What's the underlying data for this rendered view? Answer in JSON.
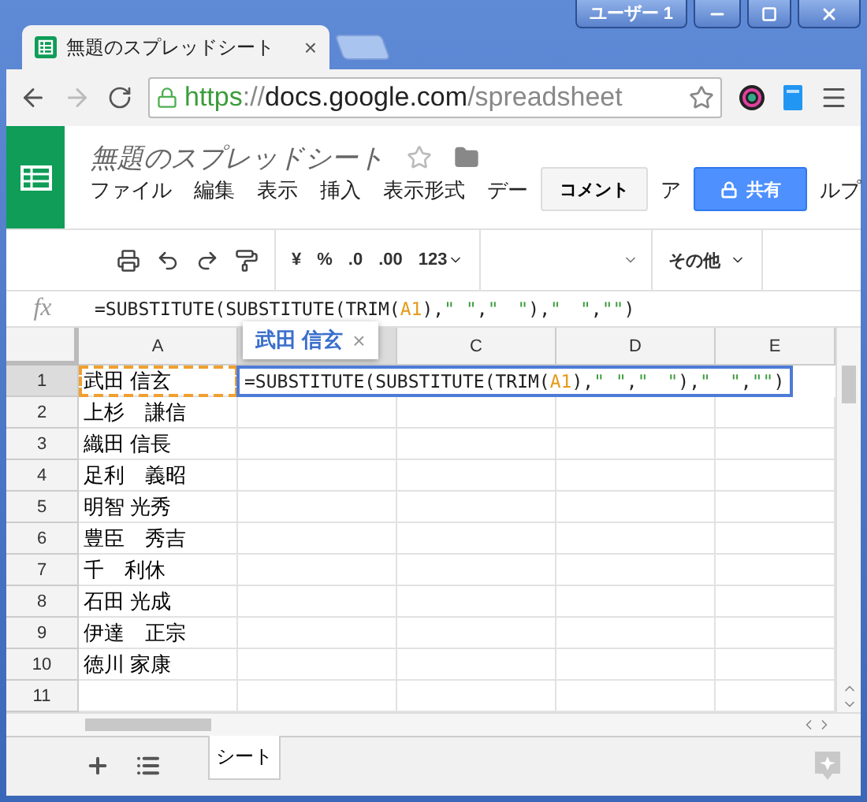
{
  "window": {
    "user_button": "ユーザー 1"
  },
  "browser_tab": {
    "title": "無題のスプレッドシート",
    "close": "×"
  },
  "address_bar": {
    "url_parts": [
      {
        "kind": "scheme",
        "text": "https"
      },
      {
        "kind": "separator",
        "text": "://"
      },
      {
        "kind": "host",
        "text": "docs.google.com"
      },
      {
        "kind": "path",
        "text": "/spreadsheet"
      }
    ]
  },
  "document": {
    "title": "無題のスプレッドシート",
    "starred": false
  },
  "menu": [
    {
      "label": "ファイル"
    },
    {
      "label": "編集"
    },
    {
      "label": "表示"
    },
    {
      "label": "挿入"
    },
    {
      "label": "表示形式"
    },
    {
      "label": "デー"
    },
    {
      "kind": "comment_button",
      "label": "コメント"
    },
    {
      "label": "ア"
    },
    {
      "kind": "share_button",
      "label": "共有"
    },
    {
      "label": "ルプ"
    }
  ],
  "toolbar": {
    "currency": "¥",
    "percent": "%",
    "decrease_decimals": ".0",
    "increase_decimals": ".00",
    "format": "123",
    "more": "その他"
  },
  "formula_bar": {
    "label": "fx",
    "tokens": [
      {
        "kind": "plain",
        "text": "=SUBSTITUTE(SUBSTITUTE(TRIM("
      },
      {
        "kind": "ref",
        "text": "A1"
      },
      {
        "kind": "plain",
        "text": "),"
      },
      {
        "kind": "string",
        "text": "\" \""
      },
      {
        "kind": "plain",
        "text": ","
      },
      {
        "kind": "string",
        "text": "\"　\""
      },
      {
        "kind": "plain",
        "text": "),"
      },
      {
        "kind": "string",
        "text": "\"　\""
      },
      {
        "kind": "plain",
        "text": ","
      },
      {
        "kind": "string",
        "text": "\"\""
      },
      {
        "kind": "plain",
        "text": ")"
      }
    ]
  },
  "columns": [
    {
      "label": "A",
      "selected": false
    },
    {
      "selected": true
    },
    {
      "label": "C",
      "selected": false
    },
    {
      "label": "D",
      "selected": false
    },
    {
      "label": "E",
      "selected": false
    }
  ],
  "rows": [
    {
      "number": "1",
      "selected": true,
      "name": "武田 信玄",
      "copied": true
    },
    {
      "number": "2",
      "selected": false,
      "name": "上杉　謙信",
      "copied": false
    },
    {
      "number": "3",
      "selected": false,
      "name": "織田 信長",
      "copied": false
    },
    {
      "number": "4",
      "selected": false,
      "name": "足利　義昭",
      "copied": false
    },
    {
      "number": "5",
      "selected": false,
      "name": "明智 光秀",
      "copied": false
    },
    {
      "number": "6",
      "selected": false,
      "name": "豊臣　秀吉",
      "copied": false
    },
    {
      "number": "7",
      "selected": false,
      "name": "千　利休",
      "copied": false
    },
    {
      "number": "8",
      "selected": false,
      "name": "石田 光成",
      "copied": false
    },
    {
      "number": "9",
      "selected": false,
      "name": "伊達　正宗",
      "copied": false
    },
    {
      "number": "10",
      "selected": false,
      "name": "徳川 家康",
      "copied": false
    },
    {
      "number": "11",
      "selected": false,
      "copied": false
    }
  ],
  "cell_editor": {
    "tokens": [
      {
        "kind": "plain",
        "text": "=SUBSTITUTE(SUBSTITUTE(TRIM("
      },
      {
        "kind": "ref",
        "text": "A1"
      },
      {
        "kind": "plain",
        "text": "),"
      },
      {
        "kind": "string",
        "text": "\" \""
      },
      {
        "kind": "plain",
        "text": ","
      },
      {
        "kind": "string",
        "text": "\"　\""
      },
      {
        "kind": "plain",
        "text": "),"
      },
      {
        "kind": "string",
        "text": "\"　\""
      },
      {
        "kind": "plain",
        "text": ","
      },
      {
        "kind": "string",
        "text": "\"\""
      },
      {
        "kind": "plain",
        "text": ")"
      }
    ]
  },
  "cell_tooltip": {
    "text": "武田 信玄",
    "close": "×"
  },
  "sheets": [
    {
      "name": "シート",
      "selected": true
    }
  ]
}
